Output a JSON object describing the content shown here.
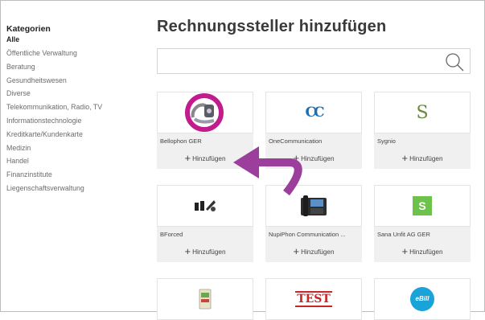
{
  "sidebar": {
    "heading": "Kategorien",
    "items": [
      {
        "label": "Alle"
      },
      {
        "label": "Öffentliche Verwaltung"
      },
      {
        "label": "Beratung"
      },
      {
        "label": "Gesundheitswesen"
      },
      {
        "label": "Diverse"
      },
      {
        "label": "Telekommunikation, Radio, TV"
      },
      {
        "label": "Informationstechnologie"
      },
      {
        "label": "Kreditkarte/Kundenkarte"
      },
      {
        "label": "Medizin"
      },
      {
        "label": "Handel"
      },
      {
        "label": "Finanzinstitute"
      },
      {
        "label": "Liegenschaftsverwaltung"
      }
    ]
  },
  "main": {
    "title": "Rechnungssteller hinzufügen",
    "search": {
      "value": "",
      "placeholder": ""
    }
  },
  "cards": [
    {
      "name": "Bellophon GER",
      "add_label": "Hinzufügen",
      "logo": "bellophon-logo"
    },
    {
      "name": "OneCommunication",
      "add_label": "Hinzufügen",
      "logo": "onecommunication-logo"
    },
    {
      "name": "Sygnio",
      "add_label": "Hinzufügen",
      "logo": "sygnio-logo"
    },
    {
      "name": "BForced",
      "add_label": "Hinzufügen",
      "logo": "bforced-logo"
    },
    {
      "name": "NupiPhon Communication ...",
      "add_label": "Hinzufügen",
      "logo": "nupiphon-logo"
    },
    {
      "name": "Sana Unfit AG GER",
      "add_label": "Hinzufügen",
      "logo": "sana-logo"
    },
    {
      "name": "",
      "add_label": "",
      "logo": "card-logo"
    },
    {
      "name": "",
      "add_label": "",
      "logo": "test-logo"
    },
    {
      "name": "",
      "add_label": "",
      "logo": "ebill-logo"
    }
  ],
  "logo_text": {
    "onecommunication": "CC",
    "sygnio": "S",
    "sana": "S",
    "test": "TEST",
    "ebill": "eBill"
  },
  "colors": {
    "annotation": "#c21b8e",
    "sana_green": "#6cc24a",
    "ebill_blue": "#1aa3d9"
  }
}
